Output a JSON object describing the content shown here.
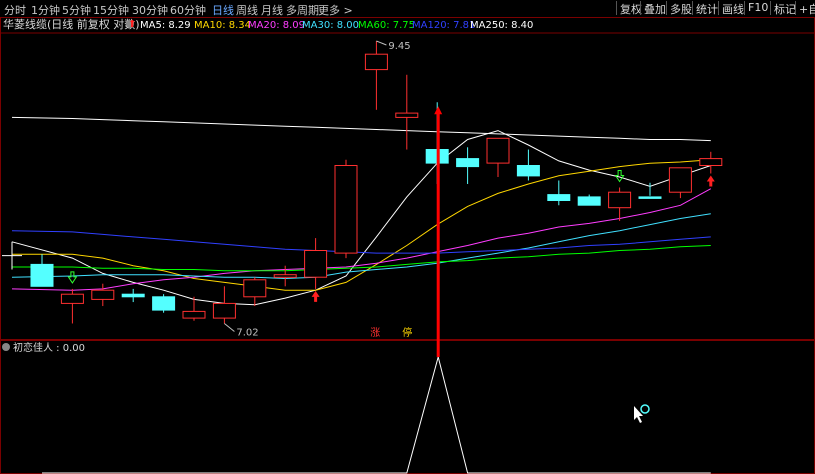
{
  "toolbar": {
    "periods": [
      "分时",
      "1分钟",
      "5分钟",
      "15分钟",
      "30分钟",
      "60分钟",
      "日线",
      "周线",
      "月线",
      "多周期",
      "更多 >"
    ],
    "active_period": "日线",
    "buttons": [
      "复权",
      "叠加",
      "多股",
      "统计",
      "画线",
      "F10",
      "标记",
      "+自"
    ]
  },
  "main_header": {
    "title": "华菱线缆(日线 前复权 对数)",
    "ma_labels": [
      {
        "text": "MA5: 8.29",
        "color": "#ffffff"
      },
      {
        "text": "MA10: 8.34",
        "color": "#ffd700"
      },
      {
        "text": "MA20: 8.09",
        "color": "#ff3dff"
      },
      {
        "text": "MA30: 8.00",
        "color": "#40e0ff"
      },
      {
        "text": "MA60: 7.75",
        "color": "#00ff00"
      },
      {
        "text": "MA120: 7.81",
        "color": "#3040ff"
      },
      {
        "text": "MA250: 8.40",
        "color": "#ffffff"
      }
    ]
  },
  "indicator_header": {
    "text": "初恋佳人 : 0.00"
  },
  "colors": {
    "up": "#ff3030",
    "down": "#54ffff",
    "grid": "#7a0000",
    "signal": "#ff0000"
  },
  "chart_data": {
    "type": "candlestick",
    "scale": "log",
    "ylim": [
      6.95,
      9.55
    ],
    "candles": [
      {
        "o": 7.47,
        "h": 7.55,
        "l": 7.35,
        "c": 7.3,
        "color": "down"
      },
      {
        "o": 7.17,
        "h": 7.28,
        "l": 7.02,
        "c": 7.24,
        "color": "up"
      },
      {
        "o": 7.2,
        "h": 7.32,
        "l": 7.15,
        "c": 7.27,
        "color": "up"
      },
      {
        "o": 7.24,
        "h": 7.28,
        "l": 7.18,
        "c": 7.22,
        "color": "down"
      },
      {
        "o": 7.22,
        "h": 7.24,
        "l": 7.1,
        "c": 7.12,
        "color": "down"
      },
      {
        "o": 7.06,
        "h": 7.22,
        "l": 7.04,
        "c": 7.11,
        "color": "up"
      },
      {
        "o": 7.06,
        "h": 7.3,
        "l": 7.02,
        "c": 7.17,
        "color": "up"
      },
      {
        "o": 7.22,
        "h": 7.37,
        "l": 7.15,
        "c": 7.35,
        "color": "up"
      },
      {
        "o": 7.37,
        "h": 7.46,
        "l": 7.3,
        "c": 7.39,
        "color": "up"
      },
      {
        "o": 7.37,
        "h": 7.68,
        "l": 7.28,
        "c": 7.58,
        "color": "up"
      },
      {
        "o": 7.56,
        "h": 8.34,
        "l": 7.52,
        "c": 8.29,
        "color": "up"
      },
      {
        "o": 9.17,
        "h": 9.45,
        "l": 8.79,
        "c": 9.32,
        "color": "up"
      },
      {
        "o": 8.72,
        "h": 9.12,
        "l": 8.43,
        "c": 8.76,
        "color": "up"
      },
      {
        "o": 8.43,
        "h": 8.86,
        "l": 8.13,
        "c": 8.31,
        "color": "down"
      },
      {
        "o": 8.35,
        "h": 8.45,
        "l": 8.13,
        "c": 8.28,
        "color": "down"
      },
      {
        "o": 8.31,
        "h": 8.5,
        "l": 8.19,
        "c": 8.53,
        "color": "up"
      },
      {
        "o": 8.29,
        "h": 8.43,
        "l": 8.16,
        "c": 8.2,
        "color": "down"
      },
      {
        "o": 8.04,
        "h": 8.16,
        "l": 7.95,
        "c": 7.99,
        "color": "down"
      },
      {
        "o": 8.02,
        "h": 8.04,
        "l": 7.95,
        "c": 7.95,
        "color": "down"
      },
      {
        "o": 7.93,
        "h": 8.1,
        "l": 7.82,
        "c": 8.06,
        "color": "up"
      },
      {
        "o": 8.01,
        "h": 8.14,
        "l": 8.03,
        "c": 8.02,
        "color": "down"
      },
      {
        "o": 8.06,
        "h": 8.22,
        "l": 8.01,
        "c": 8.27,
        "color": "up"
      },
      {
        "o": 8.29,
        "h": 8.41,
        "l": 8.22,
        "c": 8.35,
        "color": "up"
      }
    ],
    "ma_series": [
      {
        "name": "MA5",
        "color": "#ffffff",
        "values": [
          7.65,
          7.52,
          7.4,
          7.33,
          7.27,
          7.2,
          7.17,
          7.16,
          7.21,
          7.27,
          7.38,
          7.69,
          8.02,
          8.31,
          8.52,
          8.6,
          8.47,
          8.33,
          8.25,
          8.19,
          8.11,
          8.2,
          8.29
        ]
      },
      {
        "name": "MA10",
        "color": "#ffd700",
        "values": [
          7.55,
          7.55,
          7.52,
          7.46,
          7.42,
          7.36,
          7.33,
          7.3,
          7.27,
          7.27,
          7.33,
          7.47,
          7.62,
          7.79,
          7.94,
          8.05,
          8.13,
          8.2,
          8.24,
          8.28,
          8.31,
          8.32,
          8.34
        ]
      },
      {
        "name": "MA20",
        "color": "#ff3dff",
        "values": [
          7.28,
          7.27,
          7.28,
          7.32,
          7.35,
          7.37,
          7.4,
          7.42,
          7.43,
          7.44,
          7.45,
          7.48,
          7.52,
          7.57,
          7.62,
          7.68,
          7.72,
          7.77,
          7.8,
          7.84,
          7.89,
          7.95,
          8.09
        ]
      },
      {
        "name": "MA30",
        "color": "#40e0ff",
        "values": [
          7.37,
          7.38,
          7.39,
          7.39,
          7.39,
          7.38,
          7.37,
          7.37,
          7.36,
          7.37,
          7.41,
          7.43,
          7.45,
          7.48,
          7.52,
          7.56,
          7.6,
          7.65,
          7.7,
          7.74,
          7.79,
          7.84,
          7.88
        ]
      },
      {
        "name": "MA60",
        "color": "#00ff00",
        "values": [
          7.45,
          7.45,
          7.44,
          7.44,
          7.43,
          7.43,
          7.42,
          7.42,
          7.42,
          7.43,
          7.44,
          7.45,
          7.47,
          7.49,
          7.5,
          7.52,
          7.53,
          7.55,
          7.56,
          7.58,
          7.59,
          7.61,
          7.62
        ]
      },
      {
        "name": "MA120",
        "color": "#3040ff",
        "values": [
          7.74,
          7.73,
          7.71,
          7.69,
          7.67,
          7.65,
          7.63,
          7.61,
          7.59,
          7.58,
          7.57,
          7.56,
          7.56,
          7.56,
          7.57,
          7.58,
          7.59,
          7.6,
          7.62,
          7.63,
          7.65,
          7.67,
          7.69
        ]
      },
      {
        "name": "MA250",
        "color": "#ffffff",
        "values": [
          8.72,
          8.71,
          8.7,
          8.69,
          8.68,
          8.67,
          8.66,
          8.65,
          8.64,
          8.63,
          8.62,
          8.61,
          8.6,
          8.59,
          8.58,
          8.57,
          8.56,
          8.55,
          8.54,
          8.53,
          8.52,
          8.52,
          8.51
        ]
      }
    ],
    "annotations": {
      "high_label": "9.45",
      "high_index": 11,
      "low_label": "7.02",
      "low_index": 6,
      "buy_arrow_indices": [
        9,
        22
      ],
      "sell_arrow_indices": [
        1,
        19
      ],
      "signal_index": 13,
      "signal_text_1": "涨",
      "signal_text_2": "停"
    },
    "indicator": {
      "name": "初恋佳人",
      "value_label": "0.00",
      "peak_index": 13,
      "values": [
        0,
        0,
        0,
        0,
        0,
        0,
        0,
        0,
        0,
        0,
        0,
        0,
        0,
        1,
        0,
        0,
        0,
        0,
        0,
        0,
        0,
        0,
        0
      ]
    }
  }
}
